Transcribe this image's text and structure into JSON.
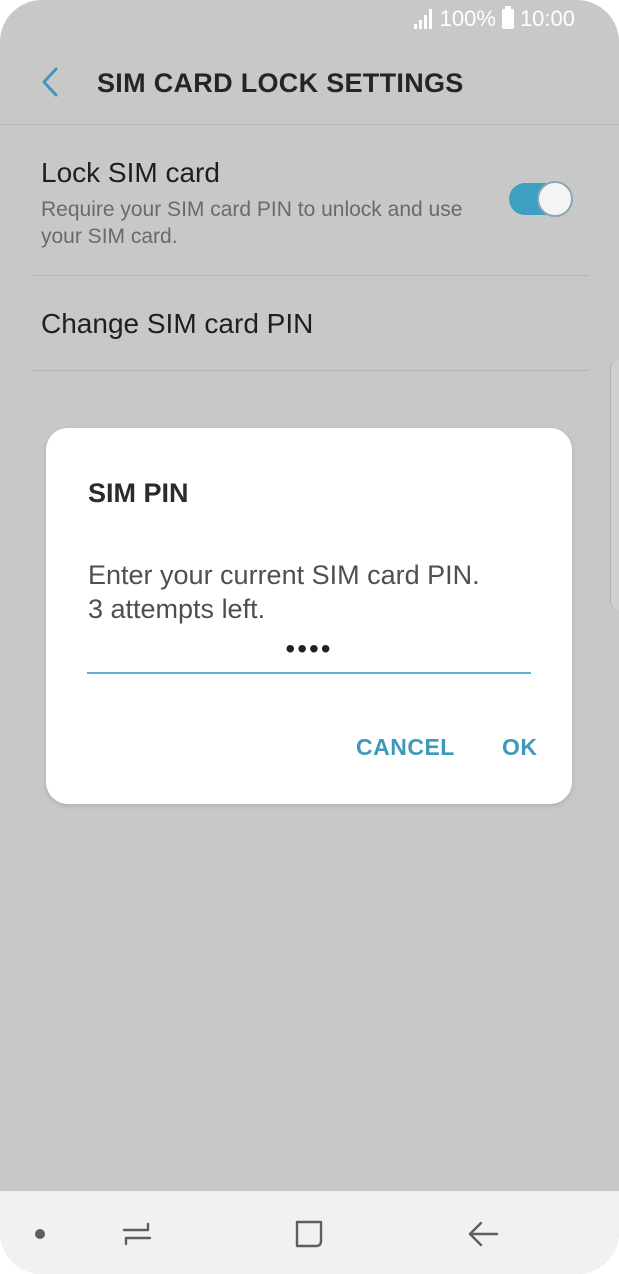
{
  "status_bar": {
    "battery_text": "100%",
    "time": "10:00",
    "icons": [
      "signal-icon",
      "battery-icon"
    ]
  },
  "app_bar": {
    "title": "SIM CARD LOCK SETTINGS",
    "back_icon": "chevron-left-icon"
  },
  "settings": {
    "lock_sim": {
      "title": "Lock SIM card",
      "subtitle": "Require your SIM card PIN to unlock and use your SIM card.",
      "enabled": true
    },
    "change_pin": {
      "title": "Change SIM card PIN"
    }
  },
  "dialog": {
    "title": "SIM PIN",
    "message_line1": "Enter your current SIM card PIN.",
    "message_line2": "3 attempts left.",
    "pin_value": "••••",
    "cancel_label": "CANCEL",
    "ok_label": "OK"
  },
  "nav_bar": {
    "icons": [
      "recent-apps-icon",
      "home-icon",
      "back-arrow-icon"
    ]
  },
  "colors": {
    "accent": "#3e98ba",
    "toggle_on": "#3f9fc3",
    "background": "#c8c8c8",
    "dialog": "#ffffff"
  }
}
